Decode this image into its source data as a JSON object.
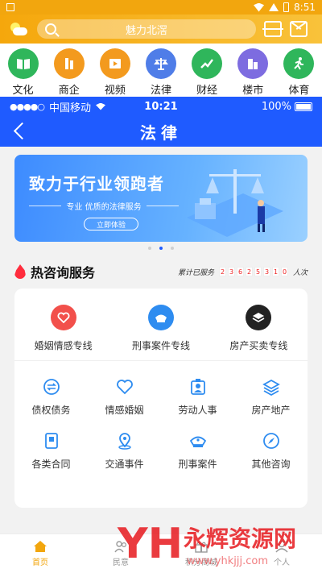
{
  "system_bar": {
    "time": "8:51"
  },
  "header": {
    "search_placeholder": "魅力北滘"
  },
  "categories": [
    {
      "label": "文化",
      "color": "#2fb65b"
    },
    {
      "label": "商企",
      "color": "#f39a1e"
    },
    {
      "label": "视频",
      "color": "#f39a1e"
    },
    {
      "label": "法律",
      "color": "#4f7de8"
    },
    {
      "label": "财经",
      "color": "#2fb65b"
    },
    {
      "label": "楼市",
      "color": "#7d6ce0"
    },
    {
      "label": "体育",
      "color": "#2fb65b"
    }
  ],
  "ios_bar": {
    "carrier": "中国移动",
    "time": "10:21",
    "battery": "100%"
  },
  "page": {
    "title": "法律"
  },
  "banner": {
    "title": "致力于行业领跑者",
    "subtitle": "专业 优质的法律服务",
    "button": "立即体验"
  },
  "pager": {
    "count": 3,
    "active": 1
  },
  "hot_section": {
    "title": "热咨询服务",
    "served_label": "累计已服务",
    "served_digits": [
      "2",
      "3",
      "6",
      "2",
      "5",
      "3",
      "1",
      "0"
    ],
    "served_unit": "人次"
  },
  "top_services": [
    {
      "label": "婚姻情感专线",
      "color": "#f2504b",
      "icon": "heart-icon"
    },
    {
      "label": "刑事案件专线",
      "color": "#2e8cf0",
      "icon": "police-cap-icon"
    },
    {
      "label": "房产买卖专线",
      "color": "#222222",
      "icon": "layers-icon"
    }
  ],
  "grid_services": [
    {
      "label": "债权债务",
      "icon": "exchange-icon"
    },
    {
      "label": "情感婚姻",
      "icon": "heart-outline-icon"
    },
    {
      "label": "劳动人事",
      "icon": "worker-badge-icon"
    },
    {
      "label": "房产地产",
      "icon": "stack-icon"
    },
    {
      "label": "各类合同",
      "icon": "contract-icon"
    },
    {
      "label": "交通事件",
      "icon": "location-pin-icon"
    },
    {
      "label": "刑事案件",
      "icon": "police-cap-outline-icon"
    },
    {
      "label": "其他咨询",
      "icon": "compass-icon"
    }
  ],
  "bottom_nav": [
    {
      "label": "首页",
      "active": true
    },
    {
      "label": "民意",
      "active": false
    },
    {
      "label": "积分商城",
      "active": false
    },
    {
      "label": "个人",
      "active": false
    }
  ],
  "watermark": {
    "brand": "永辉资源网",
    "url": "www.yhkjjj.com"
  },
  "colors": {
    "orange": "#f2a60e",
    "blue": "#1f5bff",
    "icon_blue": "#2e8cf0"
  }
}
